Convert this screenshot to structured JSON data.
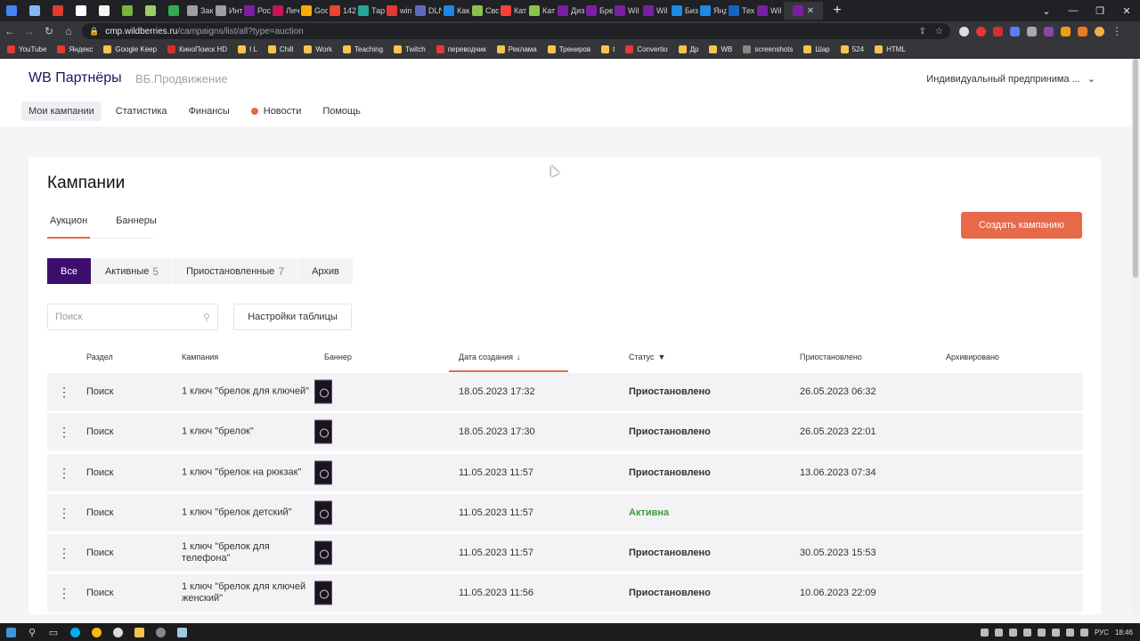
{
  "browser": {
    "tabs": [
      {
        "title": "",
        "color": "#4285f4"
      },
      {
        "title": "",
        "color": "#8ab4f8"
      },
      {
        "title": "",
        "color": "#e03c31"
      },
      {
        "title": "",
        "color": "#ffffff"
      },
      {
        "title": "",
        "color": "#f5f5f5"
      },
      {
        "title": "",
        "color": "#7cb342"
      },
      {
        "title": "",
        "color": "#9ccc65"
      },
      {
        "title": "",
        "color": "#34a853"
      },
      {
        "title": "Зак",
        "color": "#9e9e9e"
      },
      {
        "title": "Инт",
        "color": "#9e9e9e"
      },
      {
        "title": "Рос",
        "color": "#7b1fa2"
      },
      {
        "title": "Лич",
        "color": "#c2185b"
      },
      {
        "title": "Goo",
        "color": "#f9ab00"
      },
      {
        "title": "142",
        "color": "#ea4335"
      },
      {
        "title": "Тар",
        "color": "#26a69a"
      },
      {
        "title": "win",
        "color": "#e53935"
      },
      {
        "title": "DLN",
        "color": "#5c6bc0"
      },
      {
        "title": "Как",
        "color": "#1e88e5"
      },
      {
        "title": "Сво",
        "color": "#8bc34a"
      },
      {
        "title": "Кат",
        "color": "#f44336"
      },
      {
        "title": "Кат",
        "color": "#8bc34a"
      },
      {
        "title": "Диз",
        "color": "#7b1fa2"
      },
      {
        "title": "Бре",
        "color": "#7b1fa2"
      },
      {
        "title": "Wil",
        "color": "#7b1fa2"
      },
      {
        "title": "Wil",
        "color": "#7b1fa2"
      },
      {
        "title": "Биз",
        "color": "#1e88e5"
      },
      {
        "title": "Янд",
        "color": "#1e88e5"
      },
      {
        "title": "Тех",
        "color": "#1565c0"
      },
      {
        "title": "Wil",
        "color": "#7b1fa2"
      }
    ],
    "active_tab": {
      "title": "",
      "color": "#7b1fa2"
    },
    "new_tab": "+",
    "url_host": "cmp.wildberries.ru",
    "url_path": "/campaigns/list/all?type=auction",
    "bookmarks": [
      "YouTube",
      "Яндекс",
      "Google Keep",
      "КиноПоиск HD",
      "I L",
      "Chill",
      "Work",
      "Teaching",
      "Twitch",
      "переводчик",
      "Реклама",
      "Трениров",
      "t",
      "Convertio",
      "Др",
      "WB",
      "screenshots",
      "Шар",
      "524",
      "HTML"
    ]
  },
  "header": {
    "brand": "WB Партнёры",
    "brand_sub": "ВБ.Продвижение",
    "account": "Индивидуальный предпринима ...",
    "nav": [
      {
        "label": "Мои кампании",
        "active": true
      },
      {
        "label": "Статистика"
      },
      {
        "label": "Финансы"
      },
      {
        "label": "Новости",
        "dot": true
      },
      {
        "label": "Помощь"
      }
    ]
  },
  "main": {
    "title": "Кампании",
    "subtabs": [
      {
        "label": "Аукцион",
        "active": true
      },
      {
        "label": "Баннеры"
      }
    ],
    "create_button": "Создать кампанию",
    "filters": [
      {
        "label": "Все",
        "count": "",
        "active": true
      },
      {
        "label": "Активные",
        "count": "5"
      },
      {
        "label": "Приостановленные",
        "count": "7"
      },
      {
        "label": "Архив",
        "count": ""
      }
    ],
    "search_placeholder": "Поиск",
    "settings_button": "Настройки таблицы",
    "columns": [
      "Раздел",
      "Кампания",
      "Баннер",
      "Дата создания",
      "Статус",
      "Приостановлено",
      "Архивировано"
    ],
    "rows": [
      {
        "section": "Поиск",
        "campaign": "1 ключ \"брелок для ключей\"",
        "created": "18.05.2023 17:32",
        "status": "Приостановлено",
        "paused": "26.05.2023 06:32",
        "archived": ""
      },
      {
        "section": "Поиск",
        "campaign": "1 ключ \"брелок\"",
        "created": "18.05.2023 17:30",
        "status": "Приостановлено",
        "paused": "26.05.2023 22:01",
        "archived": ""
      },
      {
        "section": "Поиск",
        "campaign": "1 ключ \"брелок на рюкзак\"",
        "created": "11.05.2023 11:57",
        "status": "Приостановлено",
        "paused": "13.06.2023 07:34",
        "archived": ""
      },
      {
        "section": "Поиск",
        "campaign": "1 ключ \"брелок детский\"",
        "created": "11.05.2023 11:57",
        "status": "Активна",
        "paused": "",
        "archived": ""
      },
      {
        "section": "Поиск",
        "campaign": "1 ключ \"брелок для телефона\"",
        "created": "11.05.2023 11:57",
        "status": "Приостановлено",
        "paused": "30.05.2023 15:53",
        "archived": ""
      },
      {
        "section": "Поиск",
        "campaign": "1 ключ \"брелок для ключей женский\"",
        "created": "11.05.2023 11:56",
        "status": "Приостановлено",
        "paused": "10.06.2023 22:09",
        "archived": ""
      }
    ]
  },
  "taskbar": {
    "lang": "РУС",
    "time": "18:46"
  },
  "colors": {
    "accent": "#e8684a",
    "brand": "#3c0f6e",
    "active_status": "#3f9b3a"
  }
}
